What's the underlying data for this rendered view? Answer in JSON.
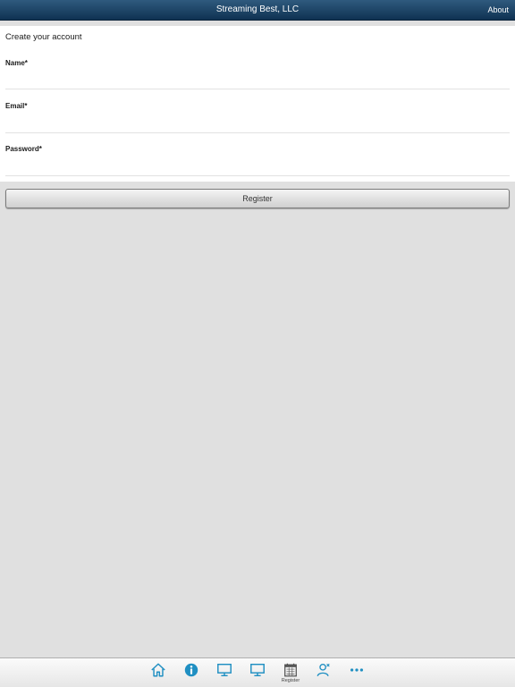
{
  "nav": {
    "title": "Streaming Best, LLC",
    "about_label": "About"
  },
  "form": {
    "heading": "Create your account",
    "fields": [
      {
        "label": "Name*",
        "value": "",
        "placeholder": ""
      },
      {
        "label": "Email*",
        "value": "",
        "placeholder": ""
      },
      {
        "label": "Password*",
        "value": "",
        "placeholder": ""
      }
    ],
    "register_label": "Register"
  },
  "tab_bar": {
    "items": [
      {
        "icon": "home-icon",
        "label": ""
      },
      {
        "icon": "info-icon",
        "label": ""
      },
      {
        "icon": "monitor-icon",
        "label": ""
      },
      {
        "icon": "monitor-icon",
        "label": ""
      },
      {
        "icon": "calendar-icon",
        "label": "Register",
        "selected": true
      },
      {
        "icon": "user-icon",
        "label": ""
      },
      {
        "icon": "more-icon",
        "label": ""
      }
    ]
  },
  "colors": {
    "nav_background": "#1b4466",
    "tab_icon": "#1f8fc2",
    "tab_icon_selected": "#555555",
    "page_background": "#e0e0e0"
  }
}
